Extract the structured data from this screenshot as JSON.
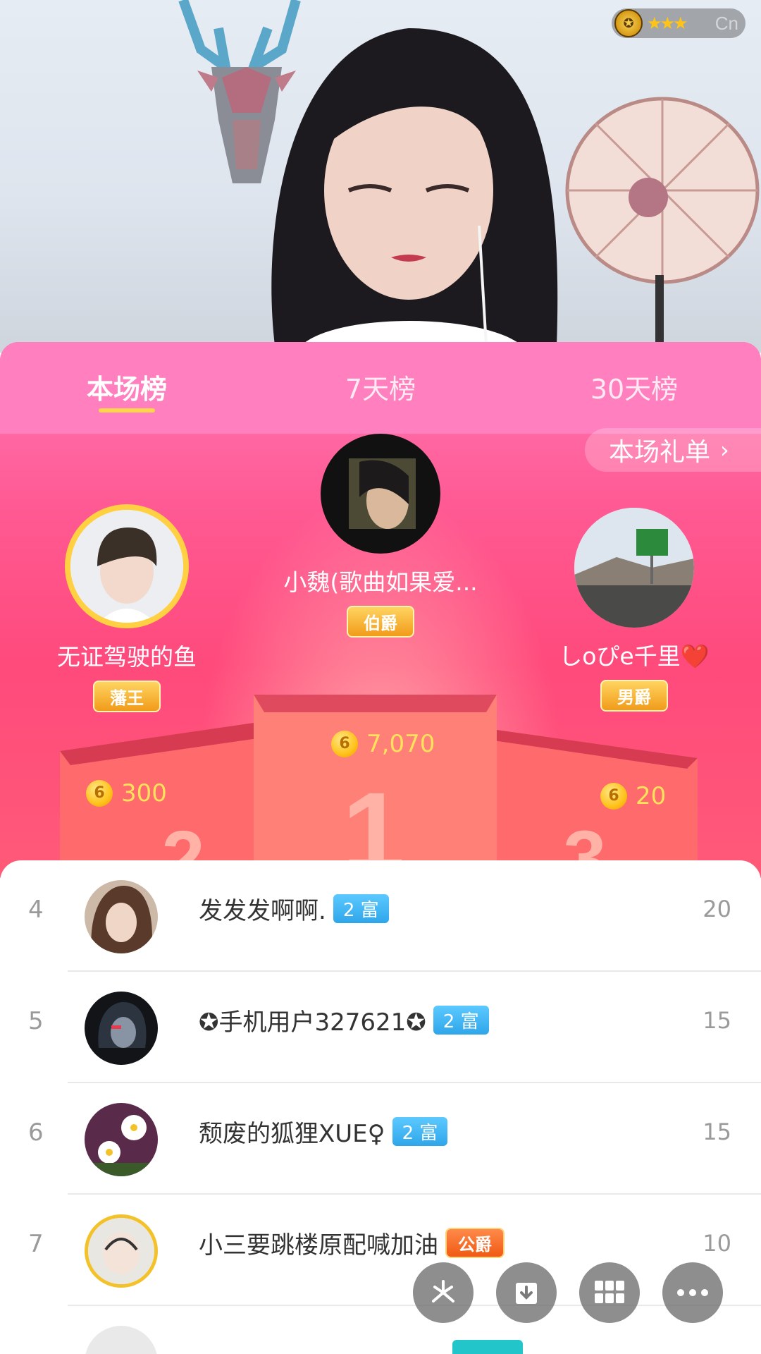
{
  "anchor": {
    "cn_watermark": "Cn"
  },
  "tabs": [
    {
      "label": "本场榜"
    },
    {
      "label": "7天榜"
    },
    {
      "label": "30天榜"
    }
  ],
  "gift_list_button": {
    "label": "本场礼单",
    "chevron": "›"
  },
  "top3": {
    "first": {
      "name": "小魏(歌曲如果爱...",
      "badge": "伯爵",
      "score": "7,070",
      "coin": "6"
    },
    "second": {
      "name": "无证驾驶的鱼",
      "badge": "藩王",
      "score": "300",
      "coin": "6"
    },
    "third": {
      "name": "しoぴe千里❤️",
      "badge": "男爵",
      "score": "20",
      "coin": "6"
    }
  },
  "list": [
    {
      "rank": "4",
      "name": "发发发啊啊.",
      "badge": "2 富",
      "value": "20"
    },
    {
      "rank": "5",
      "name": "✪手机用户327621✪",
      "badge": "2 富",
      "value": "15"
    },
    {
      "rank": "6",
      "name": "颓废的狐狸XUE♀",
      "badge": "2 富",
      "value": "15"
    },
    {
      "rank": "7",
      "name": "小三要跳楼原配喊加油",
      "badge": "公爵",
      "value": "10"
    }
  ],
  "fabs": [
    "share-icon",
    "download-icon",
    "grid-icon",
    "more-icon"
  ],
  "colors": {
    "panel_pink": "#ff5a94",
    "tab_bg": "#ff7fbf",
    "gold": "#ffd54a",
    "rich_blue": "#2fa6ea"
  }
}
